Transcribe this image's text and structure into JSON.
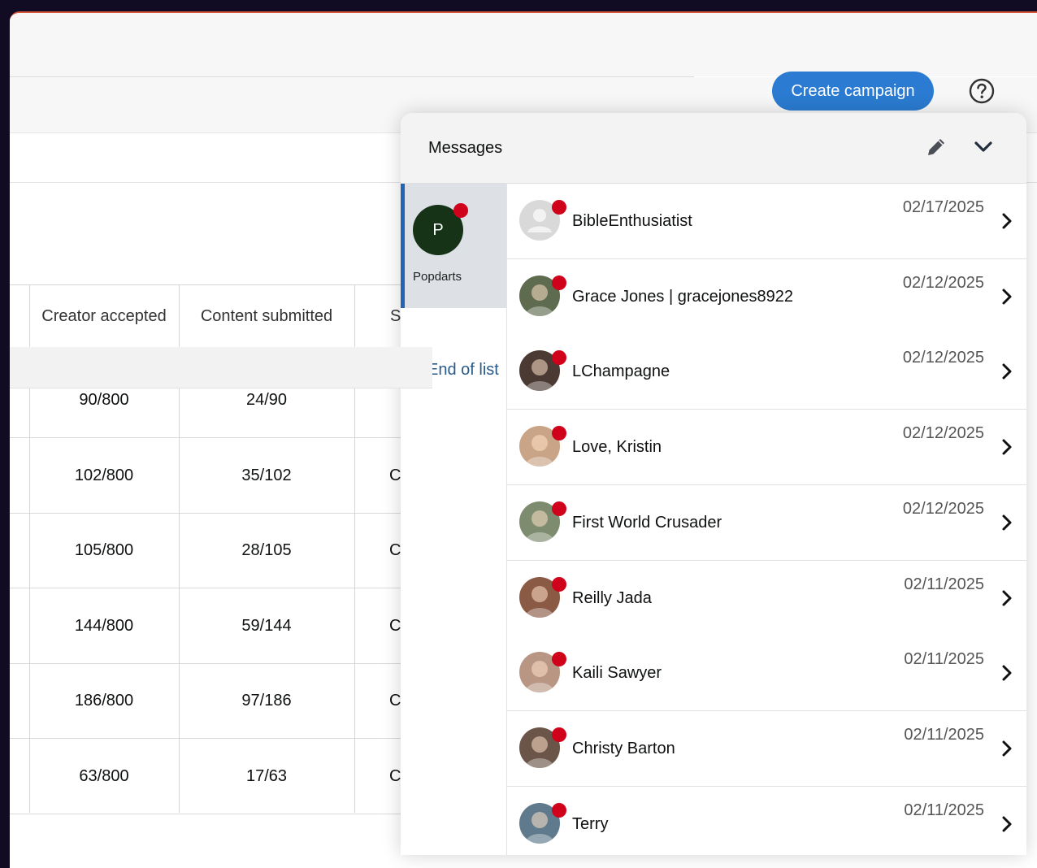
{
  "header": {
    "create_campaign_label": "Create campaign",
    "help_icon": "help-circle-icon"
  },
  "table": {
    "columns": [
      "Creator accepted",
      "Content submitted",
      "S"
    ],
    "rows": [
      {
        "creator_accepted": "90/800",
        "content_submitted": "24/90",
        "status": ""
      },
      {
        "creator_accepted": "102/800",
        "content_submitted": "35/102",
        "status": "C"
      },
      {
        "creator_accepted": "105/800",
        "content_submitted": "28/105",
        "status": "C"
      },
      {
        "creator_accepted": "144/800",
        "content_submitted": "59/144",
        "status": "C"
      },
      {
        "creator_accepted": "186/800",
        "content_submitted": "97/186",
        "status": "C"
      },
      {
        "creator_accepted": "63/800",
        "content_submitted": "17/63",
        "status": "C"
      }
    ]
  },
  "messages": {
    "title": "Messages",
    "compose_icon": "pencil-icon",
    "collapse_icon": "chevron-down-icon",
    "account": {
      "initial": "P",
      "name": "Popdarts"
    },
    "end_of_list": "End of list",
    "conversations": [
      {
        "name": "BibleEnthusiatist",
        "date": "02/17/2025",
        "avatar_color": "#d9d9d9"
      },
      {
        "name": "Grace Jones | gracejones8922",
        "date": "02/12/2025",
        "avatar_color": "#5e6b4f"
      },
      {
        "name": "LChampagne",
        "date": "02/12/2025",
        "avatar_color": "#4b3a33"
      },
      {
        "name": "Love, Kristin",
        "date": "02/12/2025",
        "avatar_color": "#c9a486"
      },
      {
        "name": "First World Crusader",
        "date": "02/12/2025",
        "avatar_color": "#7d8b6e"
      },
      {
        "name": "Reilly Jada",
        "date": "02/11/2025",
        "avatar_color": "#8a5a44"
      },
      {
        "name": "Kaili Sawyer",
        "date": "02/11/2025",
        "avatar_color": "#b89683"
      },
      {
        "name": "Christy Barton",
        "date": "02/11/2025",
        "avatar_color": "#6b5448"
      },
      {
        "name": "Terry",
        "date": "02/11/2025",
        "avatar_color": "#5f7a8c"
      }
    ]
  },
  "colors": {
    "primary_button": "#2a7bd1",
    "unread_dot": "#d0021b",
    "account_avatar": "#163317",
    "active_tab_border": "#2363b5"
  }
}
